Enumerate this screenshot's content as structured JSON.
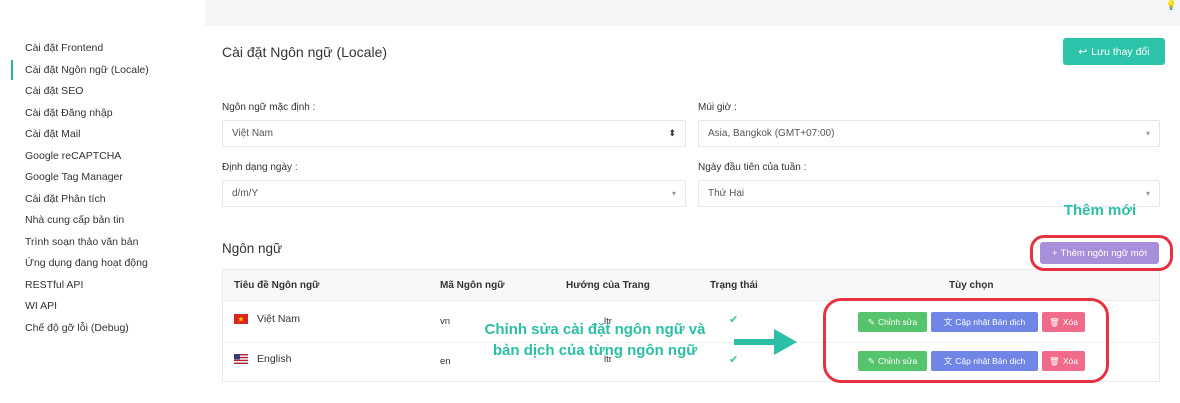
{
  "sidebar": {
    "items": [
      {
        "label": "Cài đặt Frontend",
        "active": false
      },
      {
        "label": "Cài đặt Ngôn ngữ (Locale)",
        "active": true
      },
      {
        "label": "Cài đặt SEO",
        "active": false
      },
      {
        "label": "Cài đặt Đăng nhập",
        "active": false
      },
      {
        "label": "Cài đặt Mail",
        "active": false
      },
      {
        "label": "Google reCAPTCHA",
        "active": false
      },
      {
        "label": "Google Tag Manager",
        "active": false
      },
      {
        "label": "Cài đặt Phân tích",
        "active": false
      },
      {
        "label": "Nhà cung cấp bản tin",
        "active": false
      },
      {
        "label": "Trình soạn thảo văn bản",
        "active": false
      },
      {
        "label": "Ứng dụng đang hoạt động",
        "active": false
      },
      {
        "label": "RESTful API",
        "active": false
      },
      {
        "label": "WI API",
        "active": false
      },
      {
        "label": "Chế độ gỡ lỗi (Debug)",
        "active": false
      }
    ]
  },
  "header": {
    "title": "Cài đặt Ngôn ngữ (Locale)",
    "save_label": "Lưu thay đổi"
  },
  "form": {
    "default_language": {
      "label": "Ngôn ngữ mặc định :",
      "value": "Việt Nam"
    },
    "timezone": {
      "label": "Múi giờ :",
      "value": "Asia, Bangkok (GMT+07:00)"
    },
    "date_format": {
      "label": "Định dạng ngày :",
      "value": "d/m/Y"
    },
    "week_start": {
      "label": "Ngày đầu tiên của tuần :",
      "value": "Thứ Hai"
    }
  },
  "languages": {
    "title": "Ngôn ngữ",
    "add_label": "Thêm ngôn ngữ mới",
    "columns": [
      "Tiêu đề Ngôn ngữ",
      "Mã Ngôn ngữ",
      "Hướng của Trang",
      "Trạng thái",
      "Tùy chọn"
    ],
    "rows": [
      {
        "title": "Việt Nam",
        "code": "vn",
        "direction": "ltr",
        "flag": "flag-vietnam"
      },
      {
        "title": "English",
        "code": "en",
        "direction": "ltr",
        "flag": "flag-usa"
      }
    ],
    "actions": {
      "edit": "Chỉnh sửa",
      "update": "Cập nhật Bản dịch",
      "delete": "Xóa"
    }
  },
  "annotations": {
    "add_new": "Thêm mới",
    "edit_note_line1": "Chỉnh sửa cài đặt ngôn ngữ và",
    "edit_note_line2": "bản dịch của từng ngôn ngữ",
    "color": "#2bbfa5",
    "ring_color": "#e8323f"
  },
  "colors": {
    "accent": "#2bc4a8",
    "add_button": "#a98ed9",
    "edit_button": "#56c46d",
    "update_button": "#6f86e6",
    "delete_button": "#f06a8a"
  }
}
